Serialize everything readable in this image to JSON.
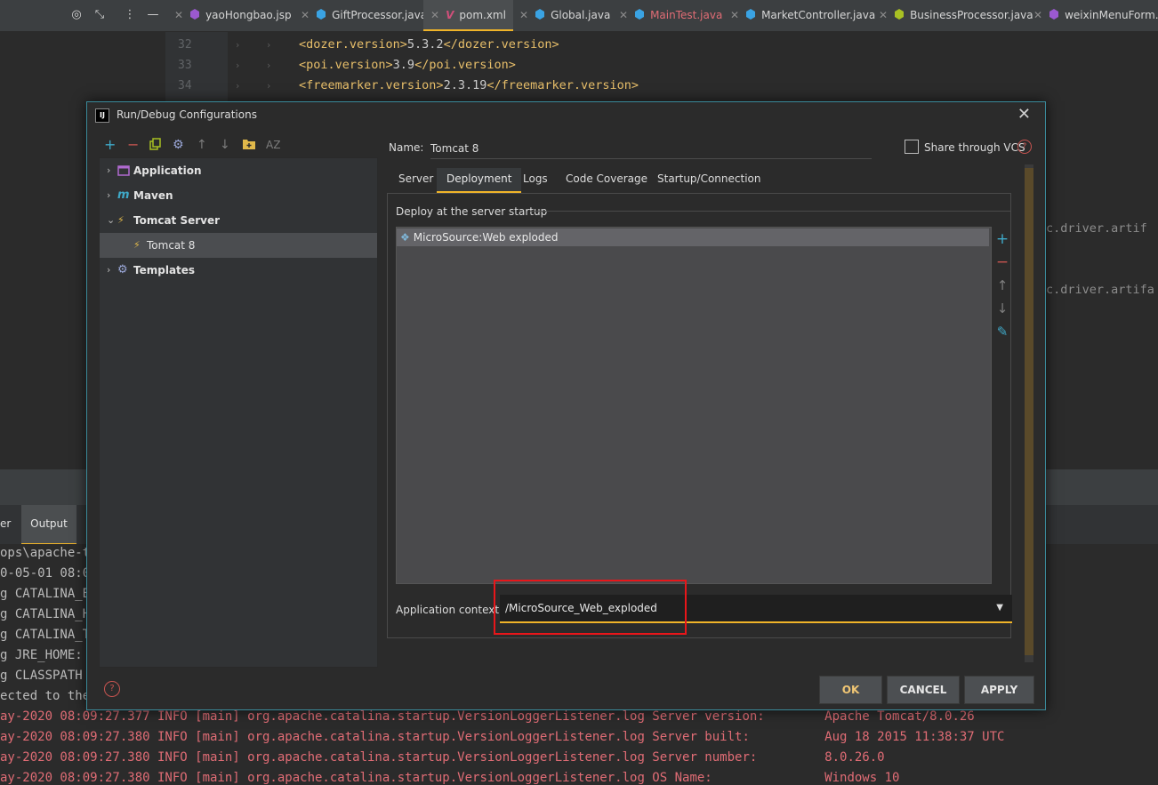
{
  "tabbar": {
    "tabs": [
      {
        "label": "yaoHongbao.jsp",
        "icon": "jsp-icon",
        "color": "#9b59d0"
      },
      {
        "label": "GiftProcessor.java",
        "icon": "class-icon",
        "color": "#3aa3e3"
      },
      {
        "label": "pom.xml",
        "icon": "maven-icon",
        "color": "#d04f7a",
        "active": true
      },
      {
        "label": "Global.java",
        "icon": "class-icon",
        "color": "#3aa3e3"
      },
      {
        "label": "MainTest.java",
        "icon": "class-icon",
        "color": "#3aa3e3",
        "error": true
      },
      {
        "label": "MarketController.java",
        "icon": "class-icon",
        "color": "#3aa3e3"
      },
      {
        "label": "BusinessProcessor.java",
        "icon": "class-icon",
        "color": "#a8c023"
      },
      {
        "label": "weixinMenuForm.jsp",
        "icon": "jsp-icon",
        "color": "#9b59d0"
      }
    ]
  },
  "editor": {
    "lines": [
      {
        "num": "32",
        "open": "<dozer.version>",
        "value": "5.3.2",
        "close": "</dozer.version>"
      },
      {
        "num": "33",
        "open": "<poi.version>",
        "value": "3.9",
        "close": "</poi.version>"
      },
      {
        "num": "34",
        "open": "<freemarker.version>",
        "value": "2.3.19",
        "close": "</freemarker.version>"
      }
    ],
    "right_fragments": [
      "c.driver.artif",
      "c.driver.artifa"
    ]
  },
  "console": {
    "tabs": [
      "er",
      "Output"
    ],
    "lines": [
      "ops\\apache-t",
      "0-05-01 08:0",
      "g CATALINA_B",
      "g CATALINA_H",
      "g CATALINA_T",
      "g JRE_HOME: ",
      "g CLASSPATH ",
      "ected to the"
    ],
    "log_lines": [
      "ay-2020 08:09:27.377 INFO [main] org.apache.catalina.startup.VersionLoggerListener.log Server version:        Apache Tomcat/8.0.26",
      "ay-2020 08:09:27.380 INFO [main] org.apache.catalina.startup.VersionLoggerListener.log Server built:          Aug 18 2015 11:38:37 UTC",
      "ay-2020 08:09:27.380 INFO [main] org.apache.catalina.startup.VersionLoggerListener.log Server number:         8.0.26.0",
      "ay-2020 08:09:27.380 INFO [main] org.apache.catalina.startup.VersionLoggerListener.log OS Name:               Windows 10"
    ]
  },
  "dialog": {
    "title": "Run/Debug Configurations",
    "tree": [
      {
        "label": "Application",
        "icon": "application-icon"
      },
      {
        "label": "Maven",
        "icon": "maven-m-icon"
      },
      {
        "label": "Tomcat Server",
        "icon": "tomcat-icon",
        "expanded": true
      },
      {
        "label": "Tomcat 8",
        "icon": "tomcat-icon",
        "selected": true
      },
      {
        "label": "Templates",
        "icon": "gear-icon"
      }
    ],
    "name_label": "Name:",
    "name_value": "Tomcat 8",
    "share_label": "Share through VCS",
    "tabs": [
      "Server",
      "Deployment",
      "Logs",
      "Code Coverage",
      "Startup/Connection"
    ],
    "deploy_title": "Deploy at the server startup",
    "artifacts": [
      "MicroSource:Web exploded"
    ],
    "context_label": "Application context:",
    "context_value": "/MicroSource_Web_exploded",
    "buttons": {
      "ok": "OK",
      "cancel": "CANCEL",
      "apply": "APPLY"
    }
  }
}
